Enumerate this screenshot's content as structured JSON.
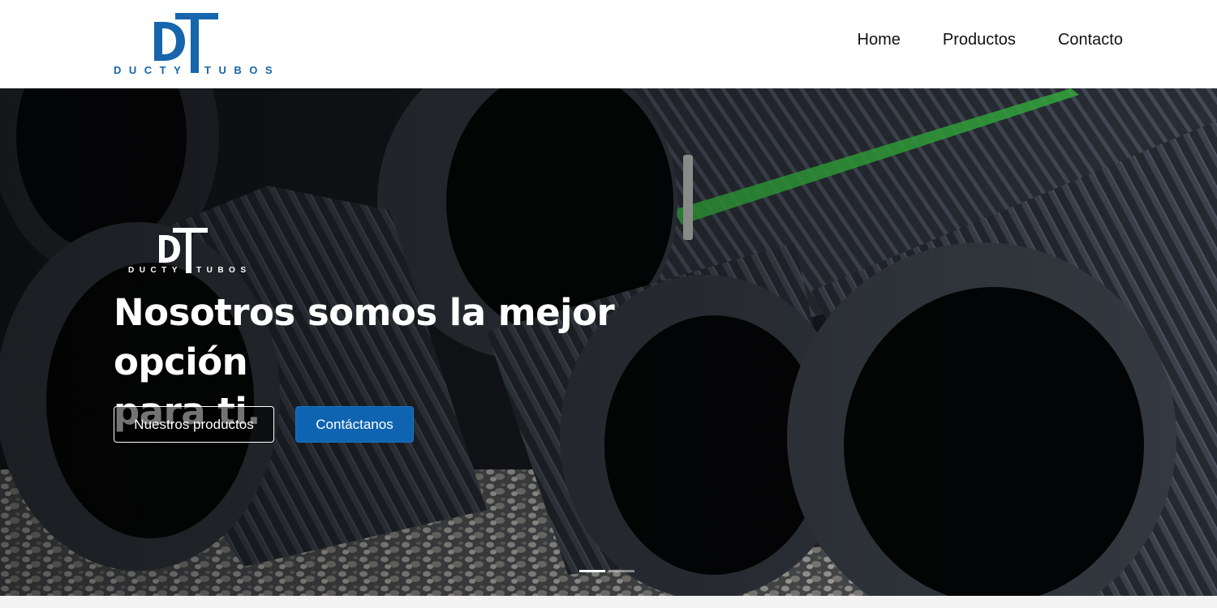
{
  "brand": {
    "left_word": "DUCTY",
    "right_word": "TUBOS",
    "color": "#1765ac"
  },
  "nav": [
    {
      "label": "Home"
    },
    {
      "label": "Productos"
    },
    {
      "label": "Contacto"
    }
  ],
  "hero": {
    "title_line1": "Nosotros somos la mejor opción",
    "title_line2": "para ti.",
    "buttons": {
      "products_label": "Nuestros productos",
      "contact_label": "Contáctanos"
    },
    "carousel": {
      "slides": 2,
      "active_slide": 1
    }
  },
  "colors": {
    "accent": "#0e64b0",
    "header_bg": "#ffffff",
    "hero_text": "#ffffff",
    "pipe_stripe": "#3ecf4a"
  }
}
